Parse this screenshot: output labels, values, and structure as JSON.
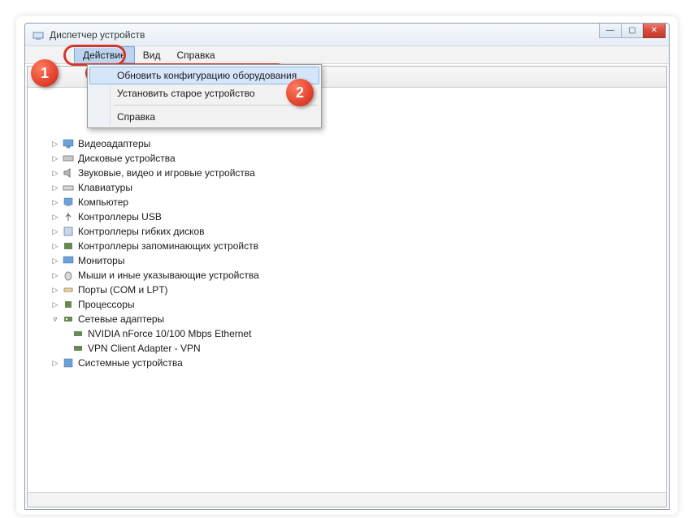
{
  "title": "Диспетчер устройств",
  "menus": {
    "action": "Действие",
    "view": "Вид",
    "help": "Справка"
  },
  "dropdown": {
    "scan": "Обновить конфигурацию оборудования",
    "legacy": "Установить старое устройство",
    "help": "Справка"
  },
  "tree": {
    "videoadapters": "Видеоадаптеры",
    "disk": "Дисковые устройства",
    "sound": "Звуковые, видео и игровые устройства",
    "keyboard": "Клавиатуры",
    "computer": "Компьютер",
    "usb": "Контроллеры USB",
    "floppy": "Контроллеры гибких дисков",
    "storage": "Контроллеры запоминающих устройств",
    "monitor": "Мониторы",
    "mouse": "Мыши и иные указывающие устройства",
    "ports": "Порты (COM и LPT)",
    "cpu": "Процессоры",
    "network": "Сетевые адаптеры",
    "nic1": "NVIDIA nForce 10/100 Mbps Ethernet",
    "nic2": "VPN Client Adapter - VPN",
    "system": "Системные устройства"
  },
  "callouts": {
    "one": "1",
    "two": "2"
  }
}
